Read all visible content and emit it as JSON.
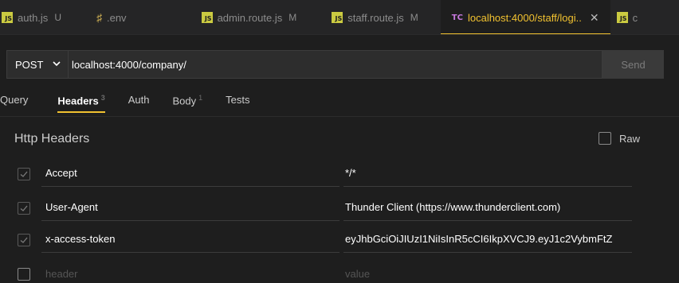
{
  "tabs": [
    {
      "label": "auth.js",
      "mod": "U",
      "icon": "js-icon"
    },
    {
      "label": ".env",
      "mod": "",
      "icon": "env-icon"
    },
    {
      "label": "admin.route.js",
      "mod": "M",
      "icon": "js-icon"
    },
    {
      "label": "staff.route.js",
      "mod": "M",
      "icon": "js-icon"
    },
    {
      "label": "localhost:4000/staff/logi..",
      "mod": "",
      "icon": "tc-icon",
      "active": true
    },
    {
      "label": "c",
      "mod": "",
      "icon": "js-icon"
    }
  ],
  "icons": {
    "env": "♯",
    "tc": "TC",
    "js": "JS",
    "close": "✕",
    "chevron": "⌄"
  },
  "request": {
    "method": "POST",
    "url": "localhost:4000/company/",
    "send_label": "Send"
  },
  "request_tabs": [
    {
      "label": "Query",
      "count": ""
    },
    {
      "label": "Headers",
      "count": "3",
      "active": true
    },
    {
      "label": "Auth",
      "count": ""
    },
    {
      "label": "Body",
      "count": "1"
    },
    {
      "label": "Tests",
      "count": ""
    }
  ],
  "headers_section": {
    "title": "Http Headers",
    "raw_label": "Raw",
    "rows": [
      {
        "key": "Accept",
        "value": "*/*",
        "checked": true
      },
      {
        "key": "User-Agent",
        "value": "Thunder Client (https://www.thunderclient.com)",
        "checked": true
      },
      {
        "key": "x-access-token",
        "value": "eyJhbGciOiJIUzI1NiIsInR5cCI6IkpXVCJ9.eyJ1c2VybmFtZ",
        "checked": true
      }
    ],
    "placeholder": {
      "key": "header",
      "value": "value"
    }
  },
  "colors": {
    "accent": "#f2c230",
    "background": "#1e1e1e",
    "tabbar": "#252526"
  }
}
